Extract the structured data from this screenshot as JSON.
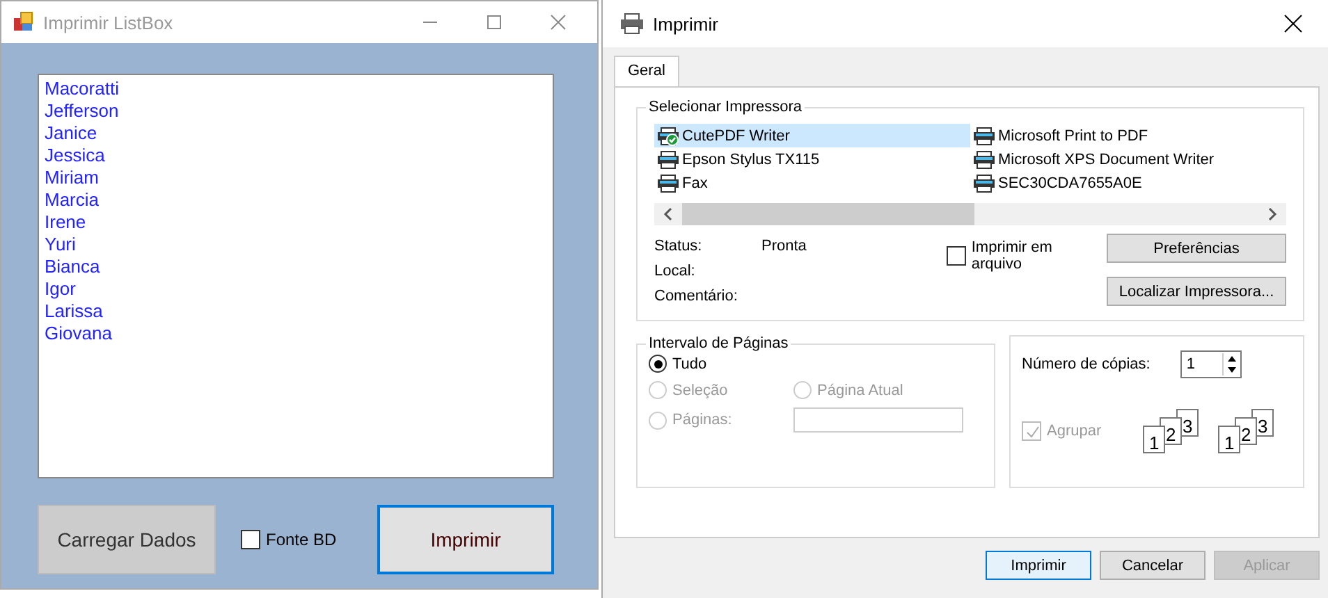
{
  "main_window": {
    "title": "Imprimir ListBox",
    "list_items": [
      "Macoratti",
      "Jefferson",
      "Janice",
      "Jessica",
      "Miriam",
      "Marcia",
      "Irene",
      "Yuri",
      "Bianca",
      "Igor",
      "Larissa",
      "Giovana"
    ],
    "load_button": {
      "label": "Carregar Dados"
    },
    "font_checkbox": {
      "label": "Fonte BD",
      "checked": false
    },
    "print_button": {
      "label": "Imprimir"
    }
  },
  "print_dialog": {
    "title": "Imprimir",
    "tabs": [
      {
        "label": "Geral",
        "selected": true
      }
    ],
    "printer_group": {
      "title": "Selecionar Impressora",
      "printers": [
        {
          "name": "CutePDF Writer",
          "selected": true,
          "default": true
        },
        {
          "name": "Epson Stylus TX115",
          "selected": false,
          "default": false
        },
        {
          "name": "Fax",
          "selected": false,
          "default": false
        },
        {
          "name": "Microsoft Print to PDF",
          "selected": false,
          "default": false
        },
        {
          "name": "Microsoft XPS Document Writer",
          "selected": false,
          "default": false
        },
        {
          "name": "SEC30CDA7655A0E",
          "selected": false,
          "default": false
        }
      ],
      "info": [
        {
          "label": "Status:",
          "value": "Pronta"
        },
        {
          "label": "Local:"
        },
        {
          "label": "Comentário:"
        }
      ],
      "print_to_file": {
        "label": "Imprimir em arquivo",
        "checked": false
      },
      "preferences_button": "Preferências",
      "find_printer_button": "Localizar Impressora..."
    },
    "page_range": {
      "title": "Intervalo de Páginas",
      "options": [
        {
          "label": "Tudo",
          "selected": true,
          "disabled": false
        },
        {
          "label": "Seleção",
          "selected": false,
          "disabled": true
        },
        {
          "label": "Página Atual",
          "selected": false,
          "disabled": true
        },
        {
          "label": "Páginas:",
          "selected": false,
          "disabled": true
        }
      ]
    },
    "copies": {
      "label": "Número de cópias:",
      "value": "1",
      "collate": {
        "label": "Agrupar",
        "checked": true,
        "disabled": true
      },
      "collate_stacks": [
        [
          "1",
          "2",
          "3"
        ],
        [
          "1",
          "2",
          "3"
        ]
      ]
    },
    "buttons": [
      {
        "label": "Imprimir",
        "disabled": false,
        "default": true
      },
      {
        "label": "Cancelar",
        "disabled": false,
        "default": false
      },
      {
        "label": "Aplicar",
        "disabled": true,
        "default": false
      }
    ]
  }
}
